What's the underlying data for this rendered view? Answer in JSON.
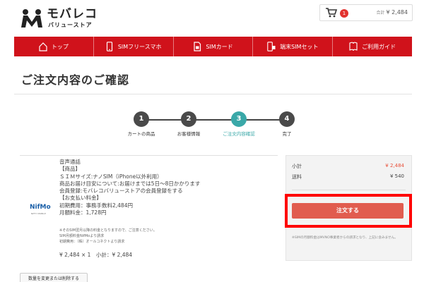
{
  "header": {
    "logo_text": "モバレコ",
    "logo_sub": "バリューストア",
    "cart_count": "1",
    "cart_total_label": "合計",
    "cart_total": "¥ 2,484"
  },
  "nav": {
    "items": [
      {
        "label": "トップ",
        "icon": "home-icon"
      },
      {
        "label": "SIMフリースマホ",
        "icon": "smartphone-icon"
      },
      {
        "label": "SIMカード",
        "icon": "sim-card-icon"
      },
      {
        "label": "端末SIMセット",
        "icon": "phone-sim-set-icon"
      },
      {
        "label": "ご利用ガイド",
        "icon": "guide-book-icon"
      }
    ]
  },
  "page": {
    "title": "ご注文内容のご確認"
  },
  "steps": [
    {
      "number": "1",
      "label": "カートの商品"
    },
    {
      "number": "2",
      "label": "お客様情報"
    },
    {
      "number": "3",
      "label": "ご注文内容確認"
    },
    {
      "number": "4",
      "label": "完了"
    }
  ],
  "product": {
    "brand": "NifMo",
    "brand_sub": "NIFTY MOBILE",
    "lines": [
      "音声通話",
      "【商品】",
      "ＳＩＭサイズ:ナノSIM（iPhone以外利用）",
      "商品お届け目安について:お届けまでは5日〜8日かかります",
      "会員登録:モバレコバリューストアの会員登録をする",
      "【お支払い料金】",
      "初期費用：事務手数料2,484円",
      "月額料金：1,728円"
    ],
    "notes": [
      "※そのSIM翌月以降の料金となりますので、ご注意ください。",
      "SIM月額料金NifMoより請求",
      "初期費用：（株）オールコネクトより請求"
    ],
    "price_line": "¥ 2,484 × 1　小計：¥ 2,484",
    "change_button": "数量を変更または削除する"
  },
  "summary": {
    "subtotal_label": "小計",
    "subtotal_value": "¥ 2,484",
    "shipping_label": "送料",
    "shipping_value": "¥ 540",
    "order_button": "注文する",
    "note": "※SIMの月額料金はMVNO事業者からの請求となり、上記に含みません。"
  },
  "colors": {
    "brand_red": "#d0121b",
    "step_active": "#3aa8a8",
    "order_button": "#e15c4f",
    "highlight": "#ff0000"
  }
}
